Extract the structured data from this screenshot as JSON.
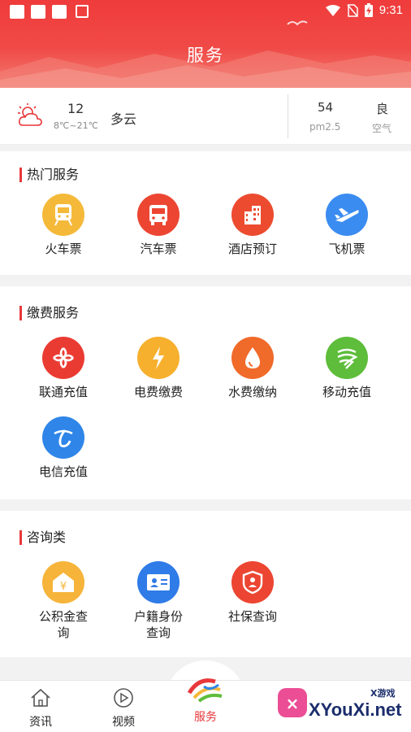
{
  "status_bar": {
    "time": "9:31"
  },
  "header": {
    "title": "服务"
  },
  "weather": {
    "temperature": "12",
    "range": "8℃~21℃",
    "condition": "多云",
    "aqi_value": "54",
    "aqi_label": "pm2.5",
    "quality_value": "良",
    "quality_label": "空气"
  },
  "sections": {
    "hot": {
      "title": "热门服务",
      "items": [
        {
          "label": "火车票",
          "icon": "train-icon",
          "color": "#f5b93a"
        },
        {
          "label": "汽车票",
          "icon": "bus-icon",
          "color": "#ec4632"
        },
        {
          "label": "酒店预订",
          "icon": "hotel-icon",
          "color": "#ec4b30"
        },
        {
          "label": "飞机票",
          "icon": "airplane-icon",
          "color": "#3b8cf0"
        }
      ]
    },
    "payment": {
      "title": "缴费服务",
      "items": [
        {
          "label": "联通充值",
          "icon": "china-unicom-icon",
          "color": "#ea3b33"
        },
        {
          "label": "电费缴费",
          "icon": "lightning-icon",
          "color": "#f6b02d"
        },
        {
          "label": "水费缴纳",
          "icon": "water-drop-icon",
          "color": "#f06a2a"
        },
        {
          "label": "移动充值",
          "icon": "china-mobile-icon",
          "color": "#5ebd3a"
        },
        {
          "label": "电信充值",
          "icon": "china-telecom-icon",
          "color": "#2f86e8"
        }
      ]
    },
    "consult": {
      "title": "咨询类",
      "items": [
        {
          "label": "公积金查询",
          "label_line1": "公积金查",
          "label_line2": "询",
          "icon": "housing-fund-icon",
          "color": "#f6b43a"
        },
        {
          "label": "户籍身份查询",
          "label_line1": "户籍身份",
          "label_line2": "查询",
          "icon": "id-card-icon",
          "color": "#2f7be8"
        },
        {
          "label": "社保查询",
          "icon": "social-security-icon",
          "color": "#ec4632"
        }
      ]
    }
  },
  "tabbar": {
    "tabs": [
      {
        "label": "资讯",
        "icon": "home-icon"
      },
      {
        "label": "视频",
        "icon": "play-icon"
      },
      {
        "label": "服务",
        "icon": "service-logo-icon",
        "active": true
      }
    ]
  },
  "watermark": {
    "brand": "XYouXi.net",
    "tag": "X游戏"
  }
}
